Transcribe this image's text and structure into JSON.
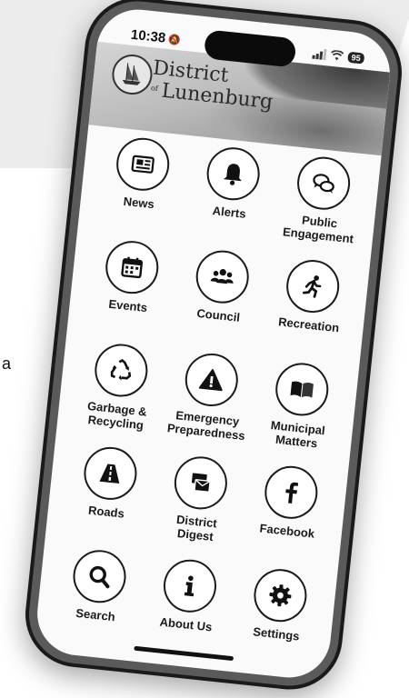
{
  "side_text": "a",
  "status_bar": {
    "time": "10:38",
    "battery": "95"
  },
  "header": {
    "logo_line1": "District",
    "logo_of": "of",
    "logo_line2": "Lunenburg"
  },
  "tiles": [
    {
      "label": "News",
      "icon": "newspaper-icon"
    },
    {
      "label": "Alerts",
      "icon": "bell-icon"
    },
    {
      "label": "Public\nEngagement",
      "icon": "chat-bubbles-icon"
    },
    {
      "label": "Events",
      "icon": "calendar-icon"
    },
    {
      "label": "Council",
      "icon": "people-group-icon"
    },
    {
      "label": "Recreation",
      "icon": "running-person-icon"
    },
    {
      "label": "Garbage &\nRecycling",
      "icon": "recycle-icon"
    },
    {
      "label": "Emergency\nPreparedness",
      "icon": "warning-triangle-icon"
    },
    {
      "label": "Municipal\nMatters",
      "icon": "open-book-icon"
    },
    {
      "label": "Roads",
      "icon": "road-icon"
    },
    {
      "label": "District\nDigest",
      "icon": "mail-envelopes-icon"
    },
    {
      "label": "Facebook",
      "icon": "facebook-icon"
    },
    {
      "label": "Search",
      "icon": "search-icon"
    },
    {
      "label": "About Us",
      "icon": "info-icon"
    },
    {
      "label": "Settings",
      "icon": "gear-icon"
    }
  ]
}
